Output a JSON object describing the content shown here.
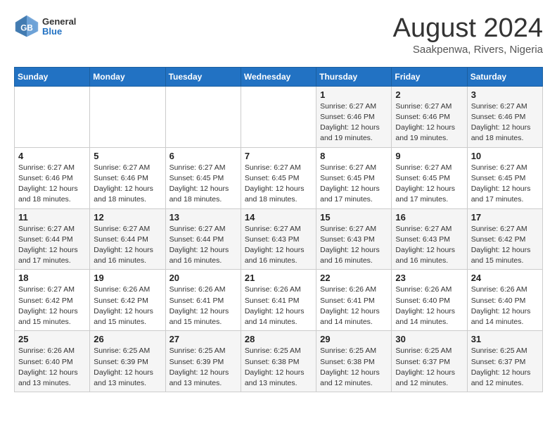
{
  "logo": {
    "general": "General",
    "blue": "Blue"
  },
  "title": "August 2024",
  "subtitle": "Saakpenwa, Rivers, Nigeria",
  "days_of_week": [
    "Sunday",
    "Monday",
    "Tuesday",
    "Wednesday",
    "Thursday",
    "Friday",
    "Saturday"
  ],
  "weeks": [
    [
      {
        "day": "",
        "detail": ""
      },
      {
        "day": "",
        "detail": ""
      },
      {
        "day": "",
        "detail": ""
      },
      {
        "day": "",
        "detail": ""
      },
      {
        "day": "1",
        "detail": "Sunrise: 6:27 AM\nSunset: 6:46 PM\nDaylight: 12 hours\nand 19 minutes."
      },
      {
        "day": "2",
        "detail": "Sunrise: 6:27 AM\nSunset: 6:46 PM\nDaylight: 12 hours\nand 19 minutes."
      },
      {
        "day": "3",
        "detail": "Sunrise: 6:27 AM\nSunset: 6:46 PM\nDaylight: 12 hours\nand 18 minutes."
      }
    ],
    [
      {
        "day": "4",
        "detail": "Sunrise: 6:27 AM\nSunset: 6:46 PM\nDaylight: 12 hours\nand 18 minutes."
      },
      {
        "day": "5",
        "detail": "Sunrise: 6:27 AM\nSunset: 6:46 PM\nDaylight: 12 hours\nand 18 minutes."
      },
      {
        "day": "6",
        "detail": "Sunrise: 6:27 AM\nSunset: 6:45 PM\nDaylight: 12 hours\nand 18 minutes."
      },
      {
        "day": "7",
        "detail": "Sunrise: 6:27 AM\nSunset: 6:45 PM\nDaylight: 12 hours\nand 18 minutes."
      },
      {
        "day": "8",
        "detail": "Sunrise: 6:27 AM\nSunset: 6:45 PM\nDaylight: 12 hours\nand 17 minutes."
      },
      {
        "day": "9",
        "detail": "Sunrise: 6:27 AM\nSunset: 6:45 PM\nDaylight: 12 hours\nand 17 minutes."
      },
      {
        "day": "10",
        "detail": "Sunrise: 6:27 AM\nSunset: 6:45 PM\nDaylight: 12 hours\nand 17 minutes."
      }
    ],
    [
      {
        "day": "11",
        "detail": "Sunrise: 6:27 AM\nSunset: 6:44 PM\nDaylight: 12 hours\nand 17 minutes."
      },
      {
        "day": "12",
        "detail": "Sunrise: 6:27 AM\nSunset: 6:44 PM\nDaylight: 12 hours\nand 16 minutes."
      },
      {
        "day": "13",
        "detail": "Sunrise: 6:27 AM\nSunset: 6:44 PM\nDaylight: 12 hours\nand 16 minutes."
      },
      {
        "day": "14",
        "detail": "Sunrise: 6:27 AM\nSunset: 6:43 PM\nDaylight: 12 hours\nand 16 minutes."
      },
      {
        "day": "15",
        "detail": "Sunrise: 6:27 AM\nSunset: 6:43 PM\nDaylight: 12 hours\nand 16 minutes."
      },
      {
        "day": "16",
        "detail": "Sunrise: 6:27 AM\nSunset: 6:43 PM\nDaylight: 12 hours\nand 16 minutes."
      },
      {
        "day": "17",
        "detail": "Sunrise: 6:27 AM\nSunset: 6:42 PM\nDaylight: 12 hours\nand 15 minutes."
      }
    ],
    [
      {
        "day": "18",
        "detail": "Sunrise: 6:27 AM\nSunset: 6:42 PM\nDaylight: 12 hours\nand 15 minutes."
      },
      {
        "day": "19",
        "detail": "Sunrise: 6:26 AM\nSunset: 6:42 PM\nDaylight: 12 hours\nand 15 minutes."
      },
      {
        "day": "20",
        "detail": "Sunrise: 6:26 AM\nSunset: 6:41 PM\nDaylight: 12 hours\nand 15 minutes."
      },
      {
        "day": "21",
        "detail": "Sunrise: 6:26 AM\nSunset: 6:41 PM\nDaylight: 12 hours\nand 14 minutes."
      },
      {
        "day": "22",
        "detail": "Sunrise: 6:26 AM\nSunset: 6:41 PM\nDaylight: 12 hours\nand 14 minutes."
      },
      {
        "day": "23",
        "detail": "Sunrise: 6:26 AM\nSunset: 6:40 PM\nDaylight: 12 hours\nand 14 minutes."
      },
      {
        "day": "24",
        "detail": "Sunrise: 6:26 AM\nSunset: 6:40 PM\nDaylight: 12 hours\nand 14 minutes."
      }
    ],
    [
      {
        "day": "25",
        "detail": "Sunrise: 6:26 AM\nSunset: 6:40 PM\nDaylight: 12 hours\nand 13 minutes."
      },
      {
        "day": "26",
        "detail": "Sunrise: 6:25 AM\nSunset: 6:39 PM\nDaylight: 12 hours\nand 13 minutes."
      },
      {
        "day": "27",
        "detail": "Sunrise: 6:25 AM\nSunset: 6:39 PM\nDaylight: 12 hours\nand 13 minutes."
      },
      {
        "day": "28",
        "detail": "Sunrise: 6:25 AM\nSunset: 6:38 PM\nDaylight: 12 hours\nand 13 minutes."
      },
      {
        "day": "29",
        "detail": "Sunrise: 6:25 AM\nSunset: 6:38 PM\nDaylight: 12 hours\nand 12 minutes."
      },
      {
        "day": "30",
        "detail": "Sunrise: 6:25 AM\nSunset: 6:37 PM\nDaylight: 12 hours\nand 12 minutes."
      },
      {
        "day": "31",
        "detail": "Sunrise: 6:25 AM\nSunset: 6:37 PM\nDaylight: 12 hours\nand 12 minutes."
      }
    ]
  ]
}
